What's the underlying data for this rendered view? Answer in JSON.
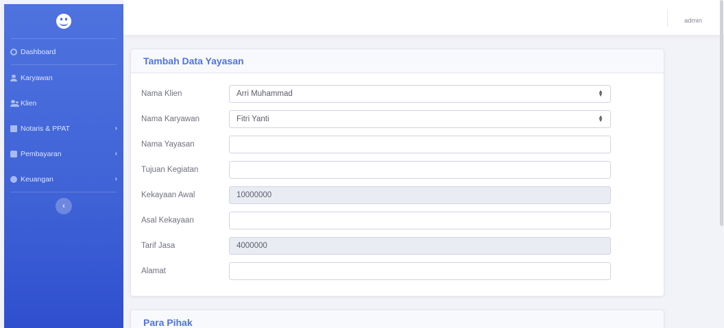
{
  "sidebar": {
    "logo_icon": "smiley-face-icon",
    "items": [
      {
        "label": "Dashboard",
        "icon": "tachometer-icon",
        "has_submenu": false
      },
      {
        "label": "Karyawan",
        "icon": "user-icon",
        "has_submenu": false
      },
      {
        "label": "Klien",
        "icon": "users-icon",
        "has_submenu": false
      },
      {
        "label": "Notaris & PPAT",
        "icon": "book-icon",
        "has_submenu": true
      },
      {
        "label": "Pembayaran",
        "icon": "money-icon",
        "has_submenu": true
      },
      {
        "label": "Keuangan",
        "icon": "coins-icon",
        "has_submenu": true
      }
    ],
    "chevron": "›",
    "toggle_glyph": "‹"
  },
  "topbar": {
    "user": "admin"
  },
  "form_card": {
    "title": "Tambah Data Yayasan",
    "fields": [
      {
        "label": "Nama Klien",
        "value": "Arri Muhammad",
        "type": "select"
      },
      {
        "label": "Nama Karyawan",
        "value": "Fitri Yanti",
        "type": "select"
      },
      {
        "label": "Nama Yayasan",
        "value": "",
        "type": "text"
      },
      {
        "label": "Tujuan Kegiatan",
        "value": "",
        "type": "text"
      },
      {
        "label": "Kekayaan Awal",
        "value": "10000000",
        "type": "readonly"
      },
      {
        "label": "Asal Kekayaan",
        "value": "",
        "type": "text"
      },
      {
        "label": "Tarif Jasa",
        "value": "4000000",
        "type": "readonly"
      },
      {
        "label": "Alamat",
        "value": "",
        "type": "text"
      }
    ]
  },
  "parties_card": {
    "title": "Para Pihak"
  },
  "colors": {
    "primary": "#4e73df",
    "sidebar_bottom": "#2f4fcf",
    "page_bg": "#f2f3f8",
    "readonly_bg": "#eaecf4"
  }
}
